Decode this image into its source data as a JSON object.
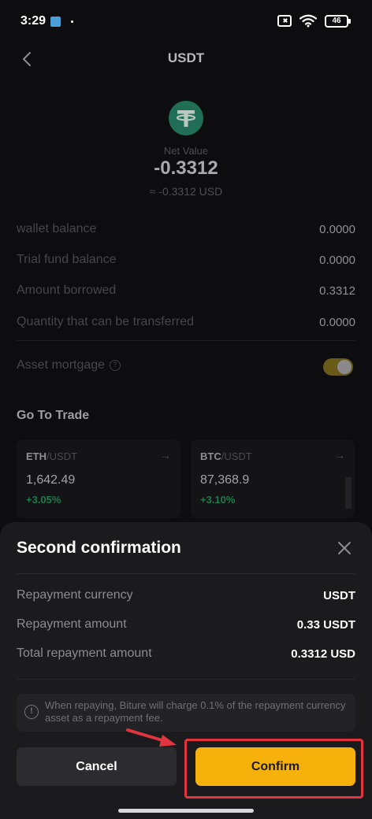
{
  "status_bar": {
    "time": "3:29",
    "battery": "46"
  },
  "header": {
    "title": "USDT",
    "back_icon": "chevron-left-icon"
  },
  "coin": {
    "logo_icon": "tether-logo",
    "brand_color": "#26a17b",
    "net_value_label": "Net Value",
    "net_value": "-0.3312",
    "net_value_fiat": "≈ -0.3312 USD"
  },
  "balances": [
    {
      "label": "wallet balance",
      "value": "0.0000"
    },
    {
      "label": "Trial fund balance",
      "value": "0.0000"
    },
    {
      "label": "Amount borrowed",
      "value": "0.3312"
    },
    {
      "label": "Quantity that can be transferred",
      "value": "0.0000"
    }
  ],
  "asset_mortgage": {
    "label": "Asset mortgage",
    "help_icon": "question-circle-icon",
    "enabled": true
  },
  "trade": {
    "section_title": "Go To Trade",
    "cards": [
      {
        "base": "ETH",
        "quote": "/USDT",
        "price": "1,642.49",
        "change": "+3.05%"
      },
      {
        "base": "BTC",
        "quote": "/USDT",
        "price": "87,368.9",
        "change": "+3.10%"
      }
    ]
  },
  "dialog": {
    "title": "Second confirmation",
    "close_icon": "close-icon",
    "rows": [
      {
        "label": "Repayment currency",
        "value": "USDT"
      },
      {
        "label": "Repayment amount",
        "value": "0.33 USDT"
      },
      {
        "label": "Total repayment amount",
        "value": "0.3312 USD"
      }
    ],
    "notice_icon": "exclamation-circle-icon",
    "notice": "When repaying, Biture will charge 0.1% of the repayment currency asset as a repayment fee.",
    "cancel_label": "Cancel",
    "confirm_label": "Confirm",
    "accent_color": "#f6b10a",
    "annotation_color": "#e0353e"
  }
}
